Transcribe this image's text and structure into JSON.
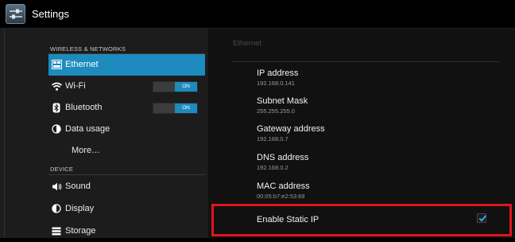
{
  "titlebar": {
    "title": "Settings",
    "icon": "settings-sliders-icon"
  },
  "sidebar": {
    "sections": [
      {
        "header": "WIRELESS & NETWORKS"
      },
      {
        "header": "DEVICE"
      }
    ],
    "items": [
      {
        "label": "Ethernet",
        "icon": "ethernet-icon",
        "active": true
      },
      {
        "label": "Wi-Fi",
        "icon": "wifi-icon",
        "toggle": "ON"
      },
      {
        "label": "Bluetooth",
        "icon": "bluetooth-icon",
        "toggle": "ON"
      },
      {
        "label": "Data usage",
        "icon": "data-usage-icon"
      },
      {
        "label": "More…"
      },
      {
        "label": "Sound",
        "icon": "speaker-icon"
      },
      {
        "label": "Display",
        "icon": "display-icon"
      },
      {
        "label": "Storage",
        "icon": "storage-icon"
      }
    ]
  },
  "main": {
    "title": "Ethernet",
    "prefs": [
      {
        "title": "IP address",
        "value": "192.168.0.141"
      },
      {
        "title": "Subnet Mask",
        "value": "255.255.255.0"
      },
      {
        "title": "Gateway address",
        "value": "192.168.0.7"
      },
      {
        "title": "DNS address",
        "value": "192.168.0.2"
      },
      {
        "title": "MAC address",
        "value": "00:05:b7:e2:53:69"
      }
    ],
    "static_ip": {
      "label": "Enable Static IP",
      "checked": true
    }
  },
  "colors": {
    "accent": "#1d8bbd",
    "highlight": "#e3131c"
  }
}
